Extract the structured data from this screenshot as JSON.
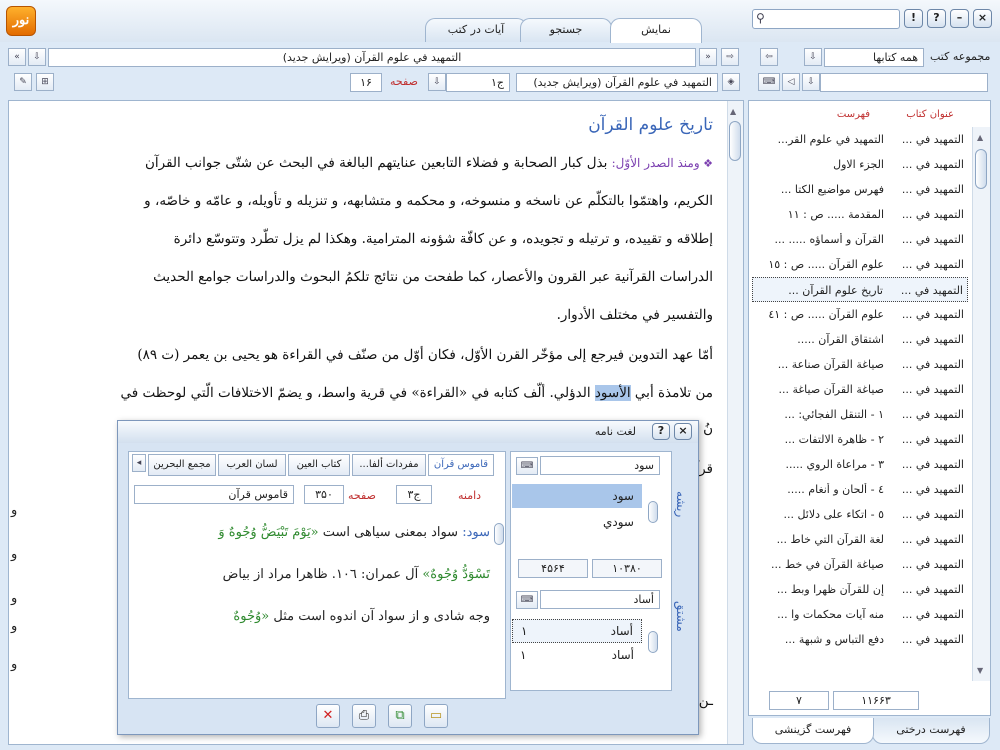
{
  "app": {
    "tabs": [
      "نمایش",
      "جستجو",
      "آيات در كتب"
    ],
    "window_buttons": [
      "!",
      "?",
      "–",
      "×"
    ]
  },
  "toolbar": {
    "book_title": "التمهيد في علوم القرآن (ويرايش جديد)",
    "section_path": "التمهيد في علوم القرآن (ويرايش جديد)",
    "volume": "ج۱",
    "page_label": "صفحه",
    "page_value": "۱۶"
  },
  "right_panel": {
    "label": "مجموعه كتب",
    "collection_value": "همه كتابها",
    "columns": [
      "عنوان كتاب",
      "فهرست"
    ],
    "rows": [
      {
        "book": "التمهيد في ...",
        "index": "التمهيد في علوم القر..."
      },
      {
        "book": "التمهيد في ...",
        "index": "الجزء الاول"
      },
      {
        "book": "التمهيد في ...",
        "index": "فهرس مواضيع الكتا ..."
      },
      {
        "book": "التمهيد في ...",
        "index": "المقدمة ..... ص : ١١"
      },
      {
        "book": "التمهيد في ...",
        "index": "القرآن و أسماؤه ..... ..."
      },
      {
        "book": "التمهيد في ...",
        "index": "علوم القرآن ..... ص : ١٥"
      },
      {
        "book": "التمهيد في ...",
        "index": "تاريخ علوم القرآن ..."
      },
      {
        "book": "التمهيد في ...",
        "index": "علوم القرآن ..... ص : ٤١"
      },
      {
        "book": "التمهيد في ...",
        "index": "اشتقاق القرآن ....."
      },
      {
        "book": "التمهيد في ...",
        "index": "صياغة القرآن صناعة ..."
      },
      {
        "book": "التمهيد في ...",
        "index": "صياغة القرآن صياغة ..."
      },
      {
        "book": "التمهيد في ...",
        "index": "١ - التنقل الفجائي: ..."
      },
      {
        "book": "التمهيد في ...",
        "index": "٢ - ظاهرة الالتفات ..."
      },
      {
        "book": "التمهيد في ...",
        "index": "٣ - مراعاة الروي ....."
      },
      {
        "book": "التمهيد في ...",
        "index": "٤ - ألحان و أنغام ....."
      },
      {
        "book": "التمهيد في ...",
        "index": "٥ - اتكاء على دلائل ..."
      },
      {
        "book": "التمهيد في ...",
        "index": "لغة القرآن التي خاط ..."
      },
      {
        "book": "التمهيد في ...",
        "index": "صياغة القرآن في خط ..."
      },
      {
        "book": "التمهيد في ...",
        "index": "إن للقرآن ظهرا وبط ..."
      },
      {
        "book": "التمهيد في ...",
        "index": "منه آيات محكمات وا ..."
      },
      {
        "book": "التمهيد في ...",
        "index": "دفع التباس و شبهة ..."
      }
    ],
    "selected_row": 6,
    "footer_count": "۱۱۶۶۳",
    "footer_page": "۷",
    "bottom_tabs": [
      "فهرست درختى",
      "فهرست گزينشى"
    ]
  },
  "content": {
    "heading": "تاريخ علوم القرآن",
    "lines": {
      "l1_lead": "ومنذ الصدر الأوّل:",
      "l1_rest": " بذل كبار الصحابة و فضلاء التابعين عنايتهم البالغة في البحث عن شتّى جوانب القرآن",
      "l2": "الكريم، واهتمّوا بالتكلّم عن ناسخه و منسوخه، و محكمه و متشابهه، و تنزيله و تأويله، و عامّه و خاصّه، و",
      "l3": "إطلاقه و تقييده، و ترتيله و تجويده، و عن كافّة شؤونه المترامية. وهكذا لم يزل تطّرد وتتوسّع دائرة",
      "l4": "الدراسات القرآنية عبر القرون والأعصار، كما طفحت من نتائج تلكمُ البحوث والدراسات جوامع الحديث",
      "l5": "والتفسير في مختلف الأدوار.",
      "l6": "أمّا عهد التدوين فيرجع إلى مؤخّر القرن الأوّل، فكان أوّل من صنّف في القراءة هو يحيى بن يعمر (ت ٨٩)",
      "l7_a": "من تلامذة أبي ",
      "l7_hl": "الأسود",
      "l7_b": " الدؤلي. ألّف كتابه في «القراءة» في قرية واسط، و يضمّ الاختلافات الّتي لوحظت في",
      "frag_1": "نُ",
      "frag_2": "قرآن».",
      "frag_w": "و",
      "frag_last": "ـن صنّف في"
    }
  },
  "dialog": {
    "title": "لغت نامه",
    "source_tabs": [
      "قاموس قرآن",
      "مفردات ألفا...",
      "كتاب العين",
      "لسان العرب",
      "مجمع البحرين"
    ],
    "info": {
      "label_range": "دامنه",
      "volume": "ج۳",
      "page_label": "صفحه",
      "page": "۳۵۰",
      "source": "قاموس قرآن"
    },
    "definition": {
      "word": "سود:",
      "p1": " سواد بمعنى سياهى است ",
      "q1": "«يَوْمَ تَبْيَضُّ وُجُوهٌ وَ",
      "q2": "تَسْوَدُّ وُجُوهٌ»",
      "p2": " آل عمران: ١٠٦. ظاهرا مراد از بياض",
      "p3": "وجه شادى و از سواد آن اندوه است مثل ",
      "q3": "«وُجُوهٌ"
    },
    "root_section": {
      "vlabel": "ريشه",
      "input": "سود",
      "items": [
        "سود",
        "سودي"
      ],
      "selected": 0,
      "counts": [
        "۱۰۳۸۰",
        "۴۵۶۴"
      ]
    },
    "deriv_section": {
      "vlabel": "مشتق",
      "input": "أساد",
      "items": [
        {
          "word": "أساد",
          "count": "۱"
        },
        {
          "word": "أساد",
          "count": "۱"
        }
      ]
    },
    "buttons": [
      "close",
      "print",
      "copy",
      "page"
    ]
  }
}
